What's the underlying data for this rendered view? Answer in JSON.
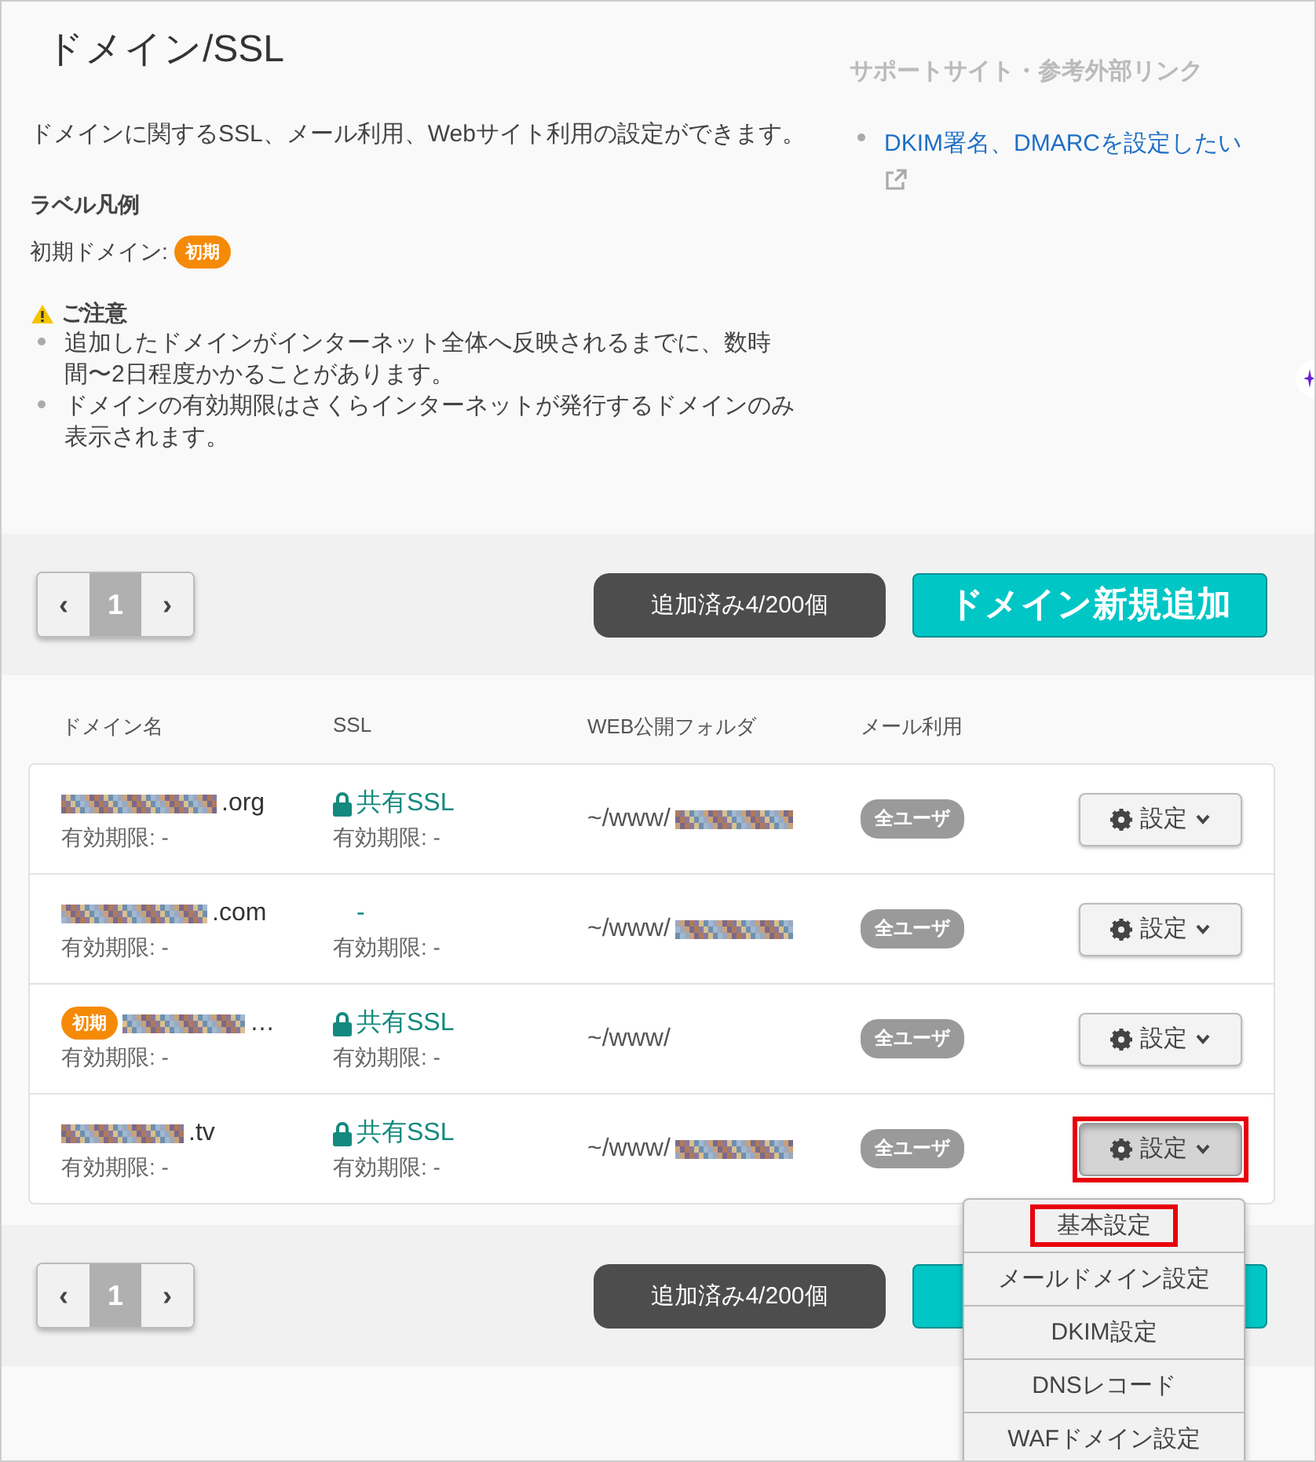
{
  "title": "ドメイン/SSL",
  "description": "ドメインに関するSSL、メール利用、Webサイト利用の設定ができます。",
  "legend": {
    "heading": "ラベル凡例",
    "label": "初期ドメイン:",
    "badge": "初期"
  },
  "notice": {
    "heading": "ご注意",
    "items": [
      "追加したドメインがインターネット全体へ反映されるまでに、数時間〜2日程度かかることがあります。",
      "ドメインの有効期限はさくらインターネットが発行するドメインのみ表示されます。"
    ]
  },
  "support": {
    "heading": "サポートサイト・参考外部リンク",
    "links": [
      {
        "label": "DKIM署名、DMARCを設定したい",
        "external": true
      }
    ]
  },
  "toolbars": [
    {
      "pager": {
        "prev": "‹",
        "page": "1",
        "next": "›"
      },
      "count": "追加済み4/200個",
      "add_button": "ドメイン新規追加"
    },
    {
      "pager": {
        "prev": "‹",
        "page": "1",
        "next": "›"
      },
      "count": "追加済み4/200個",
      "add_button_covered": true
    }
  ],
  "table": {
    "columns": [
      "ドメイン名",
      "SSL",
      "WEB公開フォルダ",
      "メール利用"
    ],
    "rows": [
      {
        "domain_redacted": true,
        "domain": ".org",
        "domain_expiry": "有効期限: -",
        "ssl_locked": true,
        "ssl": "共有SSL",
        "ssl_expiry": "有効期限: -",
        "folder": "~/www/",
        "folder_redacted": true,
        "mail": "全ユーザ",
        "settings": "設定",
        "menu_open": false,
        "highlighted": false
      },
      {
        "domain_redacted": true,
        "domain": ".com",
        "domain_expiry": "有効期限: -",
        "ssl_locked": false,
        "ssl": "-",
        "ssl_expiry": "有効期限: -",
        "folder": "~/www/",
        "folder_redacted": true,
        "mail": "全ユーザ",
        "settings": "設定",
        "menu_open": false,
        "highlighted": false
      },
      {
        "initial_badge": "初期",
        "domain_redacted": true,
        "domain": "…",
        "domain_expiry": "有効期限: -",
        "ssl_locked": true,
        "ssl": "共有SSL",
        "ssl_expiry": "有効期限: -",
        "folder": "~/www/",
        "folder_redacted": false,
        "mail": "全ユーザ",
        "settings": "設定",
        "menu_open": false,
        "highlighted": false
      },
      {
        "domain_redacted": true,
        "domain": ".tv",
        "domain_expiry": "有効期限: -",
        "ssl_locked": true,
        "ssl": "共有SSL",
        "ssl_expiry": "有効期限: -",
        "folder": "~/www/",
        "folder_redacted": true,
        "mail": "全ユーザ",
        "settings": "設定",
        "menu_open": true,
        "highlighted": true
      }
    ]
  },
  "menu": {
    "items": [
      {
        "label": "基本設定",
        "highlighted": true
      },
      {
        "label": "メールドメイン設定",
        "highlighted": false
      },
      {
        "label": "DKIM設定",
        "highlighted": false
      },
      {
        "label": "DNSレコード",
        "highlighted": false
      },
      {
        "label": "WAFドメイン設定",
        "highlighted": false
      }
    ]
  }
}
